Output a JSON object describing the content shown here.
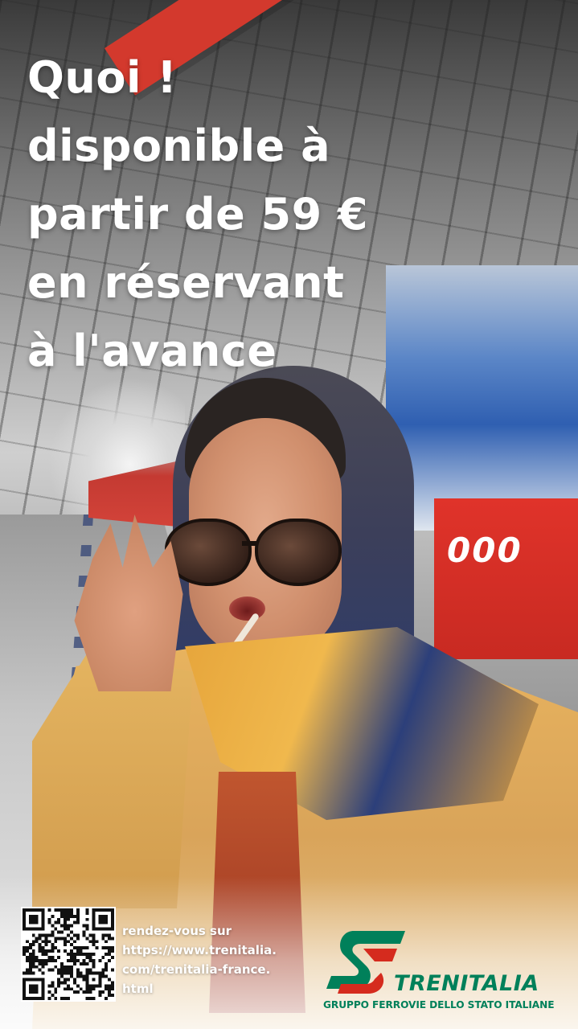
{
  "headline": {
    "lines": [
      "Quoi !",
      "disponible à",
      "partir de 59 €",
      "en réservant",
      "à l'avance"
    ]
  },
  "train_number": "000",
  "cta": {
    "lines": [
      "rendez-vous sur",
      "https://www.trenitalia.",
      "com/trenitalia-france.",
      "html"
    ]
  },
  "brand": {
    "name": "TRENITALIA",
    "group": "GRUPPO FERROVIE DELLO STATO ITALIANE",
    "colors": {
      "green": "#00805a",
      "red": "#d52b1e"
    }
  },
  "icons": [
    "qr-code-icon",
    "trenitalia-logo-icon"
  ]
}
